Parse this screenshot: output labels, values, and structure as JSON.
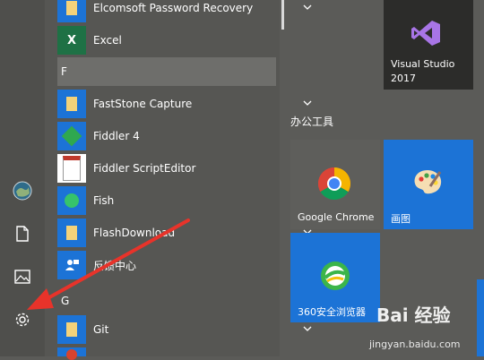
{
  "app_list": {
    "items": [
      {
        "label": "Elcomsoft Password Recovery",
        "icon": "folder-icon",
        "expand": true
      },
      {
        "label": "Excel",
        "icon": "excel-icon",
        "expand": false
      },
      {
        "label": "FastStone Capture",
        "icon": "folder-icon",
        "expand": true
      },
      {
        "label": "Fiddler 4",
        "icon": "fiddler-icon",
        "expand": false
      },
      {
        "label": "Fiddler ScriptEditor",
        "icon": "fiddler-script-icon",
        "expand": false
      },
      {
        "label": "Fish",
        "icon": "fish-icon",
        "expand": false
      },
      {
        "label": "FlashDownload",
        "icon": "folder-icon",
        "expand": true
      },
      {
        "label": "反馈中心",
        "icon": "feedback-icon",
        "expand": false
      },
      {
        "label": "Git",
        "icon": "folder-icon",
        "expand": true
      }
    ],
    "headers": [
      "F",
      "G"
    ]
  },
  "tiles": {
    "group_title": "办公工具",
    "visual_studio": "Visual Studio\n2017",
    "chrome": "Google Chrome",
    "paint": "画图",
    "browser360": "360安全浏览器"
  },
  "watermark": {
    "brand": "Bai 经验",
    "url": "jingyan.baidu.com"
  },
  "colors": {
    "tile_blue": "#1c73d6",
    "chrome_tile": "#5e5e5b",
    "vs_tile": "#2c2c2a",
    "arrow": "#e8332a"
  }
}
